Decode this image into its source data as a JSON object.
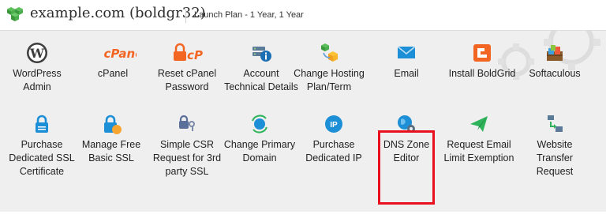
{
  "header": {
    "site_name": "example.com (boldgr32)",
    "plan": "Launch Plan - 1 Year, 1 Year",
    "site_icon": "cube-stack-icon"
  },
  "tiles_row1": [
    {
      "label": "WordPress Admin",
      "icon": "wordpress-icon"
    },
    {
      "label": "cPanel",
      "icon": "cpanel-logo-icon"
    },
    {
      "label": "Reset cPanel Password",
      "icon": "lock-cp-icon"
    },
    {
      "label": "Account Technical Details",
      "icon": "server-info-icon"
    },
    {
      "label": "Change Hosting Plan/Term",
      "icon": "blocks-icon"
    },
    {
      "label": "Email",
      "icon": "envelope-icon"
    },
    {
      "label": "Install BoldGrid",
      "icon": "boldgrid-icon"
    },
    {
      "label": "Softaculous",
      "icon": "softaculous-icon"
    }
  ],
  "tiles_row2": [
    {
      "label": "Purchase Dedicated SSL Certificate",
      "icon": "lock-icon"
    },
    {
      "label": "Manage Free Basic SSL",
      "icon": "lock-badge-icon"
    },
    {
      "label": "Simple CSR Request for 3rd party SSL",
      "icon": "lock-key-icon"
    },
    {
      "label": "Change Primary Domain",
      "icon": "globe-refresh-icon"
    },
    {
      "label": "Purchase Dedicated IP",
      "icon": "ip-icon"
    },
    {
      "label": "DNS Zone Editor",
      "icon": "globe-gear-icon"
    },
    {
      "label": "Request Email Limit Exemption",
      "icon": "paper-plane-icon"
    },
    {
      "label": "Website Transfer Request",
      "icon": "transfer-icon"
    }
  ],
  "highlighted_tile": "DNS Zone Editor",
  "colors": {
    "panel_bg": "#efefef",
    "highlight_border": "#e8101e",
    "cpanel_orange": "#f26522",
    "accent_blue": "#1c8fd6"
  }
}
